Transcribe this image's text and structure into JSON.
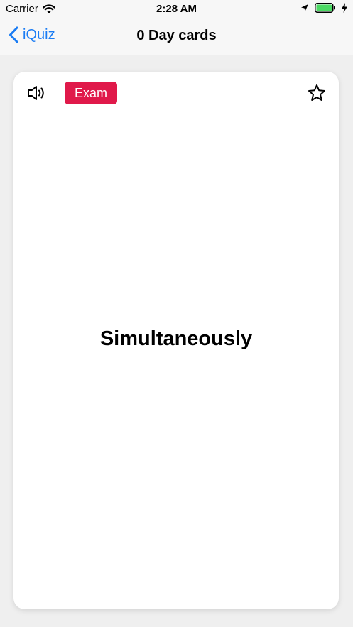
{
  "status_bar": {
    "carrier": "Carrier",
    "time": "2:28 AM"
  },
  "nav": {
    "back_label": "iQuiz",
    "title": "0 Day cards"
  },
  "card": {
    "tag": "Exam",
    "word": "Simultaneously"
  },
  "colors": {
    "accent": "#1a7cf4",
    "tag_bg": "#e0194a",
    "battery": "#4cd964"
  },
  "icons": {
    "speaker": "speaker-icon",
    "star": "star-icon",
    "back": "chevron-left-icon"
  }
}
